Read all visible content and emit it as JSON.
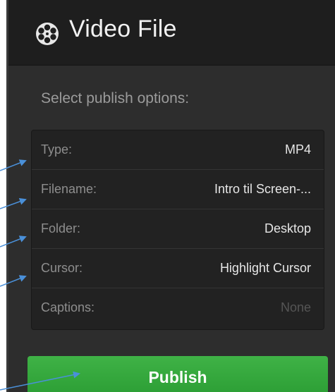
{
  "header": {
    "title": "Video File",
    "icon": "film-reel-icon"
  },
  "subtitle": "Select publish options:",
  "options": [
    {
      "label": "Type:",
      "value": "MP4"
    },
    {
      "label": "Filename:",
      "value": "Intro til Screen-..."
    },
    {
      "label": "Folder:",
      "value": "Desktop"
    },
    {
      "label": "Cursor:",
      "value": "Highlight Cursor"
    },
    {
      "label": "Captions:",
      "value": "None"
    }
  ],
  "publish_label": "Publish",
  "colors": {
    "panel": "#2d2d2d",
    "header": "#1e1e1e",
    "accent_green": "#35a83d",
    "annotation_arrow": "#4a90d9"
  }
}
